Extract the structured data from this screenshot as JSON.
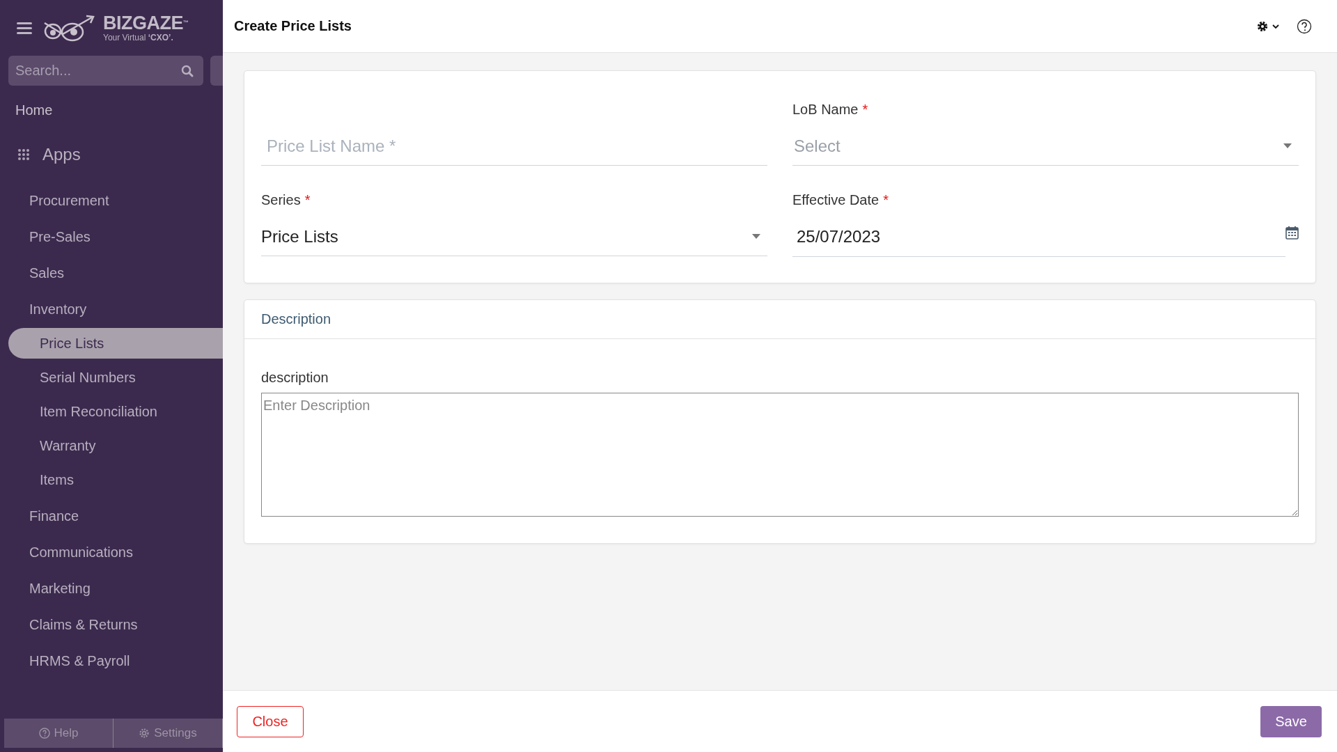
{
  "brand": {
    "name": "BIZGAZE",
    "tm": "™",
    "tagline": "Your Virtual **‘CXO’.**"
  },
  "sidebar": {
    "search": {
      "placeholder": "Search..."
    },
    "home": "Home",
    "apps_label": "Apps",
    "items": [
      {
        "label": "Procurement",
        "selected": false
      },
      {
        "label": "Pre-Sales",
        "selected": false
      },
      {
        "label": "Sales",
        "selected": false
      },
      {
        "label": "Inventory",
        "selected": false,
        "children": [
          {
            "label": "Price Lists",
            "selected": true
          },
          {
            "label": "Serial Numbers",
            "selected": false
          },
          {
            "label": "Item Reconciliation",
            "selected": false
          },
          {
            "label": "Warranty",
            "selected": false
          },
          {
            "label": "Items",
            "selected": false
          }
        ]
      },
      {
        "label": "Finance",
        "selected": false
      },
      {
        "label": "Communications",
        "selected": false
      },
      {
        "label": "Marketing",
        "selected": false
      },
      {
        "label": "Claims & Returns",
        "selected": false
      },
      {
        "label": "HRMS & Payroll",
        "selected": false
      }
    ],
    "footer": [
      "Help",
      "Settings"
    ]
  },
  "header": {
    "title": "Create Price Lists"
  },
  "form": {
    "fields": [
      {
        "kind": "text",
        "placeholder": "Price List Name *"
      },
      {
        "kind": "select",
        "label": "Series",
        "required_mark": "*",
        "value": "Price Lists"
      },
      {
        "kind": "select",
        "label": "LoB Name",
        "required_mark": "*",
        "placeholder": "Select"
      },
      {
        "kind": "date",
        "label": "Effective Date",
        "required_mark": "*",
        "value": "25/07/2023"
      }
    ]
  },
  "description": {
    "title": "Description",
    "label": "description",
    "placeholder": "Enter Description"
  },
  "buttons": {
    "close": "Close",
    "save": "Save"
  }
}
